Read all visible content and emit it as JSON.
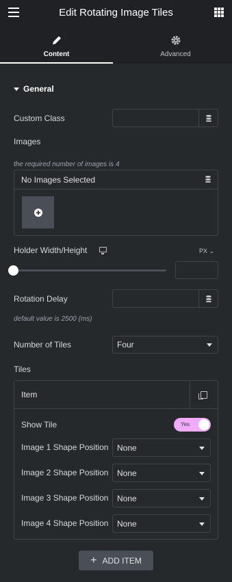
{
  "header": {
    "title": "Edit Rotating Image Tiles",
    "menu_icon": "hamburger-icon",
    "apps_icon": "grid-icon"
  },
  "tabs": [
    {
      "label": "Content",
      "icon": "pencil-icon",
      "active": true
    },
    {
      "label": "Advanced",
      "icon": "gear-icon",
      "active": false
    }
  ],
  "section": {
    "title": "General"
  },
  "fields": {
    "custom_class": {
      "label": "Custom Class",
      "value": ""
    },
    "images": {
      "label": "Images",
      "note": "the required number of images is 4",
      "empty_text": "No Images Selected"
    },
    "holder": {
      "label": "Holder Width/Height",
      "unit": "PX",
      "value": "",
      "slider_level": 0
    },
    "rotation_delay": {
      "label": "Rotation Delay",
      "value": "",
      "note": "default value is 2500 (ms)"
    },
    "number_of_tiles": {
      "label": "Number of Tiles",
      "value": "Four"
    },
    "tiles": {
      "label": "Tiles",
      "item_title": "Item",
      "show_tile": {
        "label": "Show Tile",
        "value": "Yes",
        "on": true
      },
      "positions": [
        {
          "label": "Image 1 Shape Position",
          "value": "None"
        },
        {
          "label": "Image 2 Shape Position",
          "value": "None"
        },
        {
          "label": "Image 3 Shape Position",
          "value": "None"
        },
        {
          "label": "Image 4 Shape Position",
          "value": "None"
        }
      ]
    }
  },
  "add_item": {
    "label": "ADD ITEM"
  },
  "colors": {
    "panel_bg": "#26292c",
    "header_bg": "#1f2124",
    "toggle_on": "#f0abfc"
  }
}
